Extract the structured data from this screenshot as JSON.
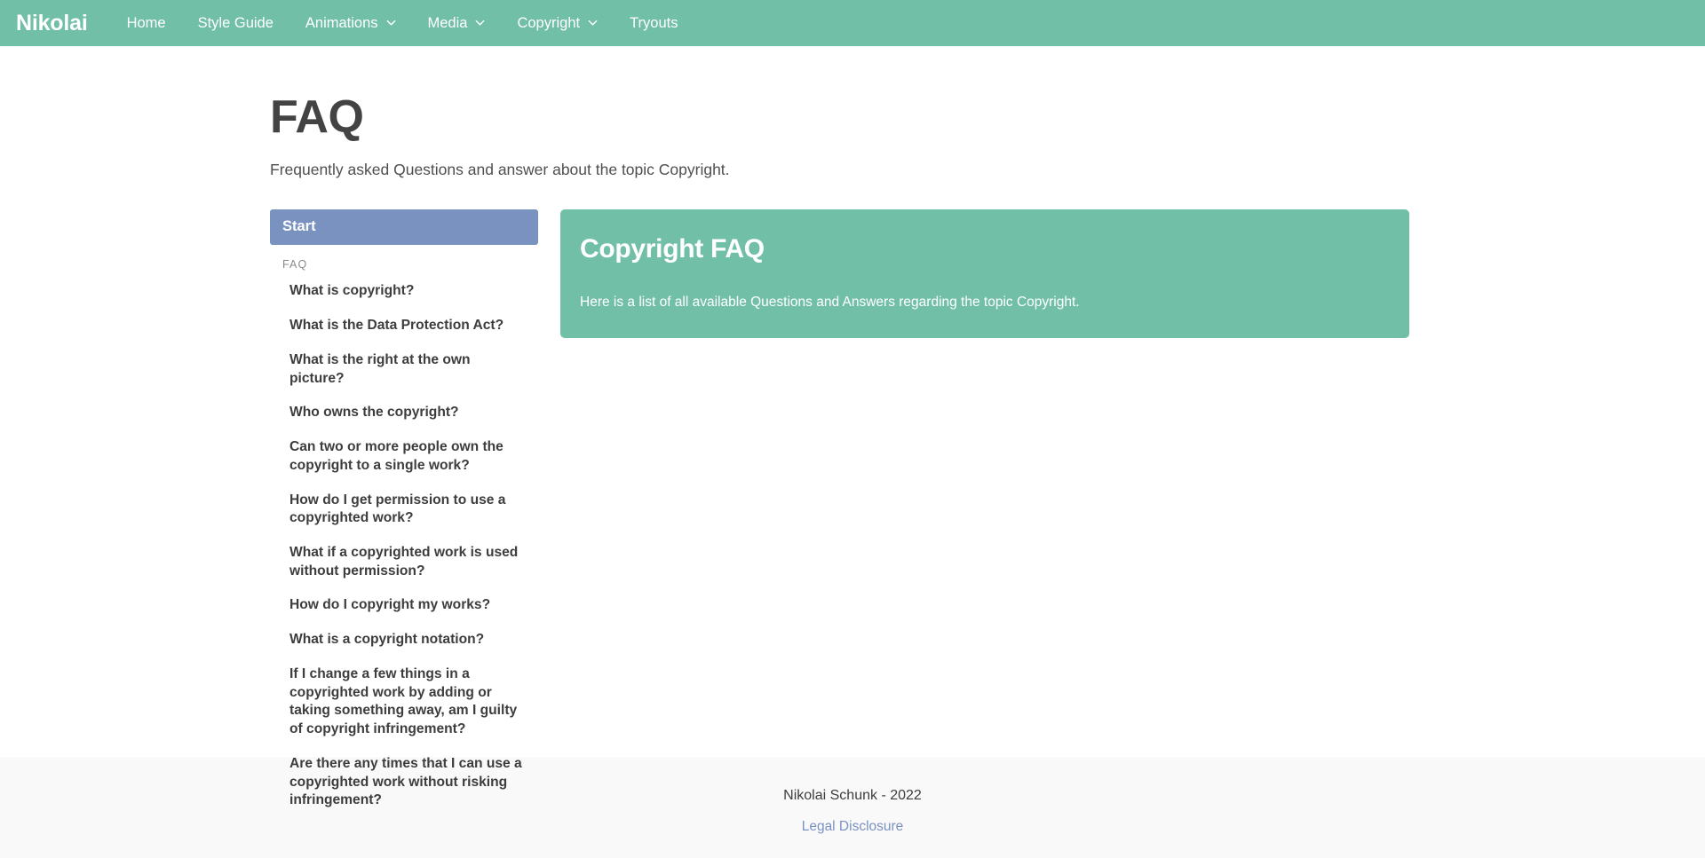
{
  "navbar": {
    "brand": "Nikolai",
    "background_color": "#71bfa7",
    "items": [
      {
        "label": "Home",
        "has_dropdown": false
      },
      {
        "label": "Style Guide",
        "has_dropdown": false
      },
      {
        "label": "Animations",
        "has_dropdown": true
      },
      {
        "label": "Media",
        "has_dropdown": true
      },
      {
        "label": "Copyright",
        "has_dropdown": true
      },
      {
        "label": "Tryouts",
        "has_dropdown": false
      }
    ]
  },
  "page": {
    "title": "FAQ",
    "subtitle": "Frequently asked Questions and answer about the topic Copyright."
  },
  "sidebar": {
    "start_label": "Start",
    "start_color": "#7a92c0",
    "section_label": "FAQ",
    "items": [
      {
        "label": "What is copyright?"
      },
      {
        "label": "What is the Data Protection Act?"
      },
      {
        "label": "What is the right at the own picture?"
      },
      {
        "label": "Who owns the copyright?"
      },
      {
        "label": "Can two or more people own the copyright to a single work?"
      },
      {
        "label": "How do I get permission to use a copyrighted work?"
      },
      {
        "label": "What if a copyrighted work is used without permission?"
      },
      {
        "label": "How do I copyright my works?"
      },
      {
        "label": "What is a copyright notation?"
      },
      {
        "label": "If I change a few things in a copyrighted work by adding or taking something away, am I guilty of copyright infringement?"
      },
      {
        "label": "Are there any times that I can use a copyrighted work without risking infringement?"
      }
    ]
  },
  "main": {
    "card": {
      "title": "Copyright FAQ",
      "text": "Here is a list of all available Questions and Answers regarding the topic Copyright.",
      "background_color": "#71bfa7"
    }
  },
  "footer": {
    "copyright": "Nikolai Schunk - 2022",
    "link_label": "Legal Disclosure",
    "link_color": "#7a92c0",
    "background_color": "#f9f9fa"
  }
}
